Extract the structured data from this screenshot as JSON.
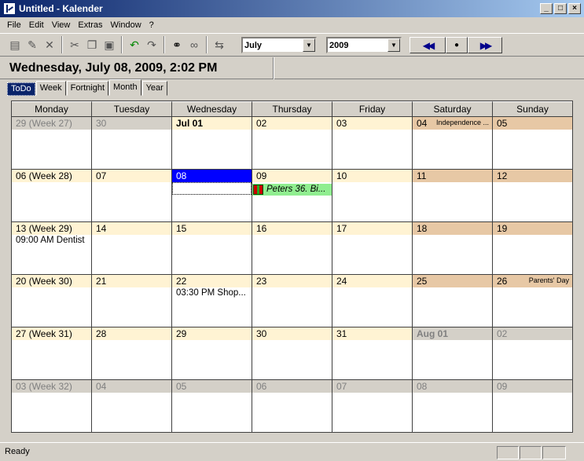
{
  "window": {
    "title": "Untitled - Kalender"
  },
  "menu": [
    "File",
    "Edit",
    "View",
    "Extras",
    "Window",
    "?"
  ],
  "toolbar": {
    "month_select": "July",
    "year_select": "2009",
    "prev_glyph": "◀◀",
    "today_glyph": "●",
    "next_glyph": "▶▶"
  },
  "current_datetime": "Wednesday, July 08, 2009, 2:02 PM",
  "tabs": [
    "ToDo",
    "Week",
    "Fortnight",
    "Month",
    "Year"
  ],
  "active_tab": "Month",
  "weekdays": [
    "Monday",
    "Tuesday",
    "Wednesday",
    "Thursday",
    "Friday",
    "Saturday",
    "Sunday"
  ],
  "weeks": [
    [
      {
        "label": "29 (Week 27)",
        "other": true
      },
      {
        "label": "30",
        "other": true
      },
      {
        "label": "Jul 01",
        "bold": true
      },
      {
        "label": "02"
      },
      {
        "label": "03"
      },
      {
        "label": "04",
        "weekend": true,
        "holiday": "Independence ...",
        "pink": true
      },
      {
        "label": "05",
        "weekend": true
      }
    ],
    [
      {
        "label": "06 (Week 28)"
      },
      {
        "label": "07"
      },
      {
        "label": "08",
        "selected": true
      },
      {
        "label": "09",
        "events": [
          {
            "text": "Peters 36. Bi...",
            "style": "green"
          }
        ]
      },
      {
        "label": "10"
      },
      {
        "label": "11",
        "weekend": true
      },
      {
        "label": "12",
        "weekend": true
      }
    ],
    [
      {
        "label": "13 (Week 29)",
        "events": [
          {
            "text": "09:00 AM Dentist"
          }
        ]
      },
      {
        "label": "14"
      },
      {
        "label": "15"
      },
      {
        "label": "16"
      },
      {
        "label": "17"
      },
      {
        "label": "18",
        "weekend": true
      },
      {
        "label": "19",
        "weekend": true
      }
    ],
    [
      {
        "label": "20 (Week 30)"
      },
      {
        "label": "21"
      },
      {
        "label": "22",
        "events": [
          {
            "text": "03:30 PM Shop..."
          }
        ]
      },
      {
        "label": "23"
      },
      {
        "label": "24"
      },
      {
        "label": "25",
        "weekend": true
      },
      {
        "label": "26",
        "weekend": true,
        "holiday": "Parents' Day"
      }
    ],
    [
      {
        "label": "27 (Week 31)"
      },
      {
        "label": "28"
      },
      {
        "label": "29"
      },
      {
        "label": "30"
      },
      {
        "label": "31"
      },
      {
        "label": "Aug 01",
        "other": true,
        "weekend": true,
        "bold": true
      },
      {
        "label": "02",
        "other": true,
        "weekend": true
      }
    ],
    [
      {
        "label": "03 (Week 32)",
        "other": true
      },
      {
        "label": "04",
        "other": true
      },
      {
        "label": "05",
        "other": true
      },
      {
        "label": "06",
        "other": true
      },
      {
        "label": "07",
        "other": true
      },
      {
        "label": "08",
        "other": true,
        "weekend": true
      },
      {
        "label": "09",
        "other": true,
        "weekend": true
      }
    ]
  ],
  "status": "Ready"
}
